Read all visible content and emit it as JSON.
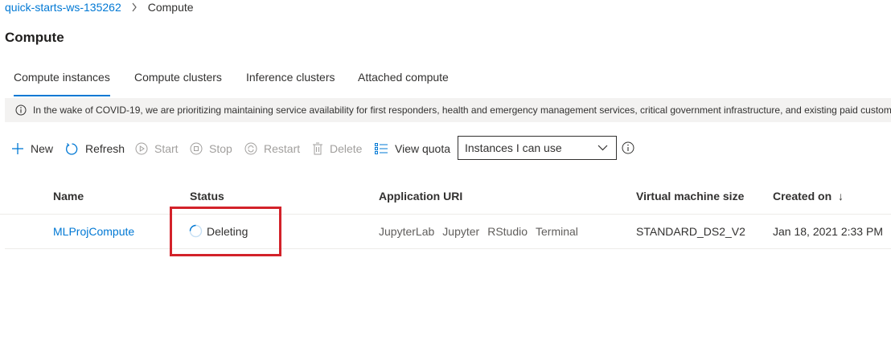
{
  "breadcrumb": {
    "workspace": "quick-starts-ws-135262",
    "current": "Compute"
  },
  "page": {
    "title": "Compute"
  },
  "tabs": [
    {
      "label": "Compute instances",
      "active": true
    },
    {
      "label": "Compute clusters",
      "active": false
    },
    {
      "label": "Inference clusters",
      "active": false
    },
    {
      "label": "Attached compute",
      "active": false
    }
  ],
  "banner": {
    "text": "In the wake of COVID-19, we are prioritizing maintaining service availability for first responders, health and emergency management services, critical government infrastructure, and existing paid customers"
  },
  "toolbar": {
    "new": "New",
    "refresh": "Refresh",
    "start": "Start",
    "stop": "Stop",
    "restart": "Restart",
    "delete": "Delete",
    "view_quota": "View quota",
    "filter_selected": "Instances I can use"
  },
  "table": {
    "columns": [
      "Name",
      "Status",
      "Application URI",
      "Virtual machine size",
      "Created on"
    ],
    "sort_indicator": "↓",
    "rows": [
      {
        "name": "MLProjCompute",
        "status": "Deleting",
        "uris": [
          "JupyterLab",
          "Jupyter",
          "RStudio",
          "Terminal"
        ],
        "vm_size": "STANDARD_DS2_V2",
        "created_on": "Jan 18, 2021 2:33 PM"
      }
    ]
  },
  "colors": {
    "accent": "#0078d4",
    "highlight": "#d3222a",
    "disabled": "#a19f9d"
  }
}
